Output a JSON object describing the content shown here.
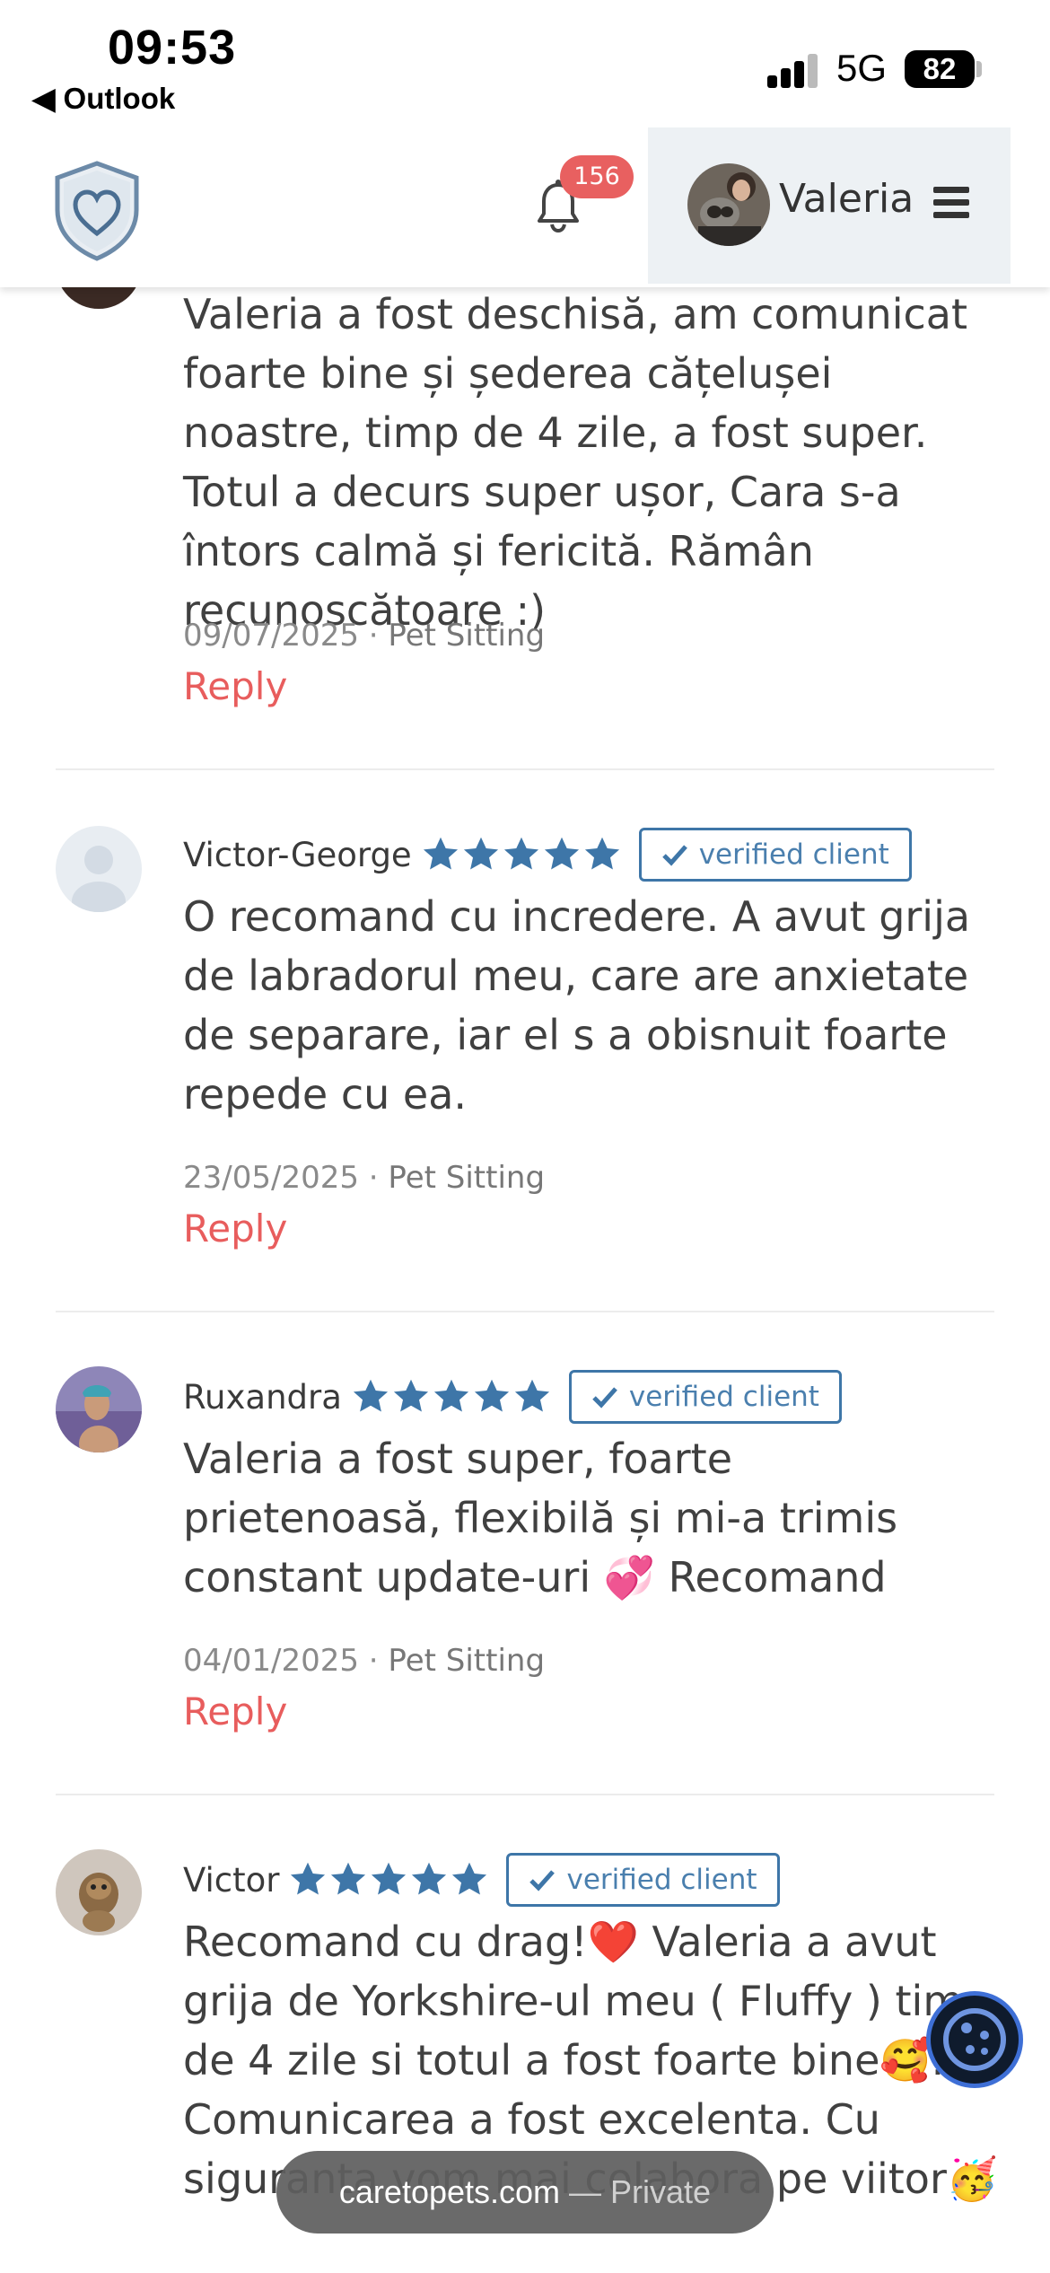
{
  "status_bar": {
    "time": "09:53",
    "back_app": "◀ Outlook",
    "network": "5G",
    "battery": "82"
  },
  "header": {
    "notification_count": "156",
    "user_name": "Valeria"
  },
  "reviews": [
    {
      "name": "",
      "text": "Valeria a fost deschisă, am comunicat foarte bine și șederea cățelușei noastre, timp de 4 zile, a fost super. Totul a decurs super ușor, Cara s-a întors calmă și fericită. Rămân recunoscătoare :)",
      "date": "09/07/2025",
      "service": "Pet Sitting",
      "reply_label": "Reply"
    },
    {
      "name": "Victor-George",
      "rating": 5,
      "verified_label": "verified client",
      "text": "O recomand cu incredere. A avut grija de labradorul meu, care are anxietate de separare, iar el s a obisnuit foarte repede cu ea.",
      "date": "23/05/2025",
      "service": "Pet Sitting",
      "reply_label": "Reply"
    },
    {
      "name": "Ruxandra",
      "rating": 5,
      "verified_label": "verified client",
      "text": "Valeria a fost super, foarte prietenoasă, flexibilă și mi-a trimis constant update-uri 💞 Recomand",
      "date": "04/01/2025",
      "service": "Pet Sitting",
      "reply_label": "Reply"
    },
    {
      "name": "Victor",
      "rating": 5,
      "verified_label": "verified client",
      "text": "Recomand cu drag!❤️ Valeria a avut grija de Yorkshire-ul meu ( Fluffy ) timp de 4 zile si totul a fost foarte bine🥰. Comunicarea a fost excelenta. Cu siguranta vom mai colabora pe viitor🥳"
    }
  ],
  "browser": {
    "domain": "caretopets.com",
    "mode": " — Private"
  },
  "colors": {
    "star": "#3e76a8",
    "reply": "#e85d5d",
    "badge": "#e86060"
  }
}
